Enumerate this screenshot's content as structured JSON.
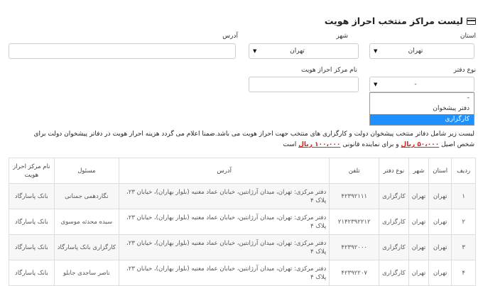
{
  "page": {
    "title": "لیست مراکز منتخب احراز هویت",
    "icon": "credit-card-icon"
  },
  "filters": {
    "province": {
      "label": "استان",
      "value": "تهران"
    },
    "city": {
      "label": "شهر",
      "value": "تهران"
    },
    "address": {
      "label": "آدرس",
      "value": ""
    },
    "office_type": {
      "label": "نوع دفتر",
      "value": "-"
    },
    "center_name": {
      "label": "نام مرکز احراز هویت",
      "value": ""
    }
  },
  "office_type_dropdown": {
    "options": [
      "-",
      "دفتر پیشخوان",
      "کارگزاری"
    ],
    "selected_index": 2
  },
  "notice": {
    "line1": "لیست زیر شامل دفاتر منتخب پیشخوان دولت و کارگزاری های منتخب جهت احراز هویت می باشد.ضمنا اعلام می گردد هزینه احراز هویت در دفاتر پیشخوان دولت برای",
    "line2_a": "شخص اصیل",
    "price1": "۵۰،۰۰۰ ریال",
    "line2_b": "و برای نماینده قانونی",
    "price2": "۱۰۰،۰۰۰ ریال",
    "line2_c": "است"
  },
  "table": {
    "headers": {
      "index": "ردیف",
      "province": "استان",
      "city": "شهر",
      "office_type": "نوع دفتر",
      "phone": "تلفن",
      "address": "آدرس",
      "manager": "مسئول",
      "center_name": "نام مرکز احراز هویت"
    },
    "rows": [
      {
        "index": "۱",
        "province": "تهران",
        "city": "تهران",
        "office_type": "کارگزاری",
        "phone": "۴۲۳۹۲۱۱۱",
        "address": "دفتر مرکزی: تهران، میدان آرژانتین، خیابان عماد مغنیه (بلوار بهاران)، خیابان ۲۳، پلاک ۴",
        "manager": "نگاردهمی جمنانی",
        "center_name": "بانک پاسارگاد"
      },
      {
        "index": "۲",
        "province": "تهران",
        "city": "تهران",
        "office_type": "کارگزاری",
        "phone": "۲۱۴۲۳۹۲۲۱۲",
        "address": "دفتر مرکزی: تهران، میدان آرژانتین، خیابان عماد مغنیه (بلوار بهاران)، خیابان ۲۳، پلاک ۴",
        "manager": "سیده محدثه موسوی",
        "center_name": "بانک پاسارگاد"
      },
      {
        "index": "۳",
        "province": "تهران",
        "city": "تهران",
        "office_type": "کارگزاری",
        "phone": "۴۲۳۹۲۰۰۰",
        "address": "دفتر مرکزی: تهران، میدان آرژانتین، خیابان عماد مغنیه (بلوار بهاران)، خیابان ۲۳، پلاک ۴",
        "manager": "کارگزاری بانک پاسارگاد",
        "center_name": "بانک پاسارگاد"
      },
      {
        "index": "۴",
        "province": "تهران",
        "city": "تهران",
        "office_type": "کارگزاری",
        "phone": "۴۲۳۹۲۲۰۷",
        "address": "دفتر مرکزی: تهران، میدان آرژانتین، خیابان عماد مغنیه (بلوار بهاران)، خیابان ۲۳، پلاک ۴",
        "manager": "ناصر ساجدی جابلو",
        "center_name": "بانک پاسارگاد"
      }
    ]
  }
}
